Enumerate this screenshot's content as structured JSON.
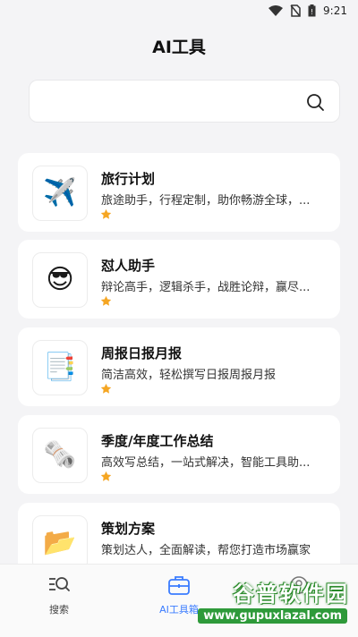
{
  "status_bar": {
    "time": "9:21"
  },
  "header": {
    "title": "AI工具"
  },
  "search": {
    "placeholder": ""
  },
  "tools": [
    {
      "name": "旅行计划",
      "desc": "旅途助手，行程定制，助你畅游全球，...",
      "icon": "✈️",
      "icon_name": "airplane-icon"
    },
    {
      "name": "怼人助手",
      "desc": "辩论高手，逻辑杀手，战胜论辩，赢尽...",
      "icon": "😎",
      "icon_name": "sunglasses-face-icon"
    },
    {
      "name": "周报日报月报",
      "desc": "简洁高效，轻松撰写日报周报月报",
      "icon": "📑",
      "icon_name": "document-icon"
    },
    {
      "name": "季度/年度工作总结",
      "desc": "高效写总结，一站式解决，智能工具助...",
      "icon": "🗞️",
      "icon_name": "rolled-newspaper-icon"
    },
    {
      "name": "策划方案",
      "desc": "策划达人，全面解读，帮您打造市场赢家",
      "icon": "📂",
      "icon_name": "folder-icon"
    }
  ],
  "bottom_nav": [
    {
      "label": "搜索",
      "icon": "search-list-icon",
      "active": false
    },
    {
      "label": "AI工具箱",
      "icon": "toolbox-icon",
      "active": true
    },
    {
      "label": "",
      "icon": "profile-icon",
      "active": false
    }
  ],
  "watermark": {
    "title": "谷普软件园",
    "url": "www.gupuxlazal.com"
  },
  "colors": {
    "accent": "#3b7cff",
    "star": "#f5a623",
    "background": "#f4f4f6"
  }
}
